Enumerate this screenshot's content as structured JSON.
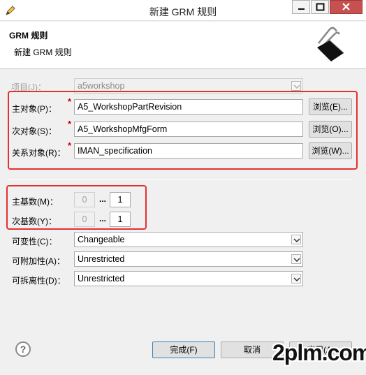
{
  "window": {
    "title": "新建 GRM 规则",
    "icon": "pencil-icon"
  },
  "header": {
    "title": "GRM 规则",
    "subtitle": "新建 GRM 规则",
    "icon": "binder-clip-icon"
  },
  "project": {
    "label": "项目(J)：",
    "value": "a5workshop"
  },
  "primary": {
    "label": "主对象(P)：",
    "value": "A5_WorkshopPartRevision",
    "browse": "浏览(E)..."
  },
  "secondary": {
    "label": "次对象(S)：",
    "value": "A5_WorkshopMfgForm",
    "browse": "浏览(O)..."
  },
  "relation": {
    "label": "关系对象(R)：",
    "value": "IMAN_specification",
    "browse": "浏览(W)..."
  },
  "required_mark": "*",
  "primary_card": {
    "label": "主基数(M)：",
    "min": "0",
    "sep": "...",
    "max": "1"
  },
  "secondary_card": {
    "label": "次基数(Y)：",
    "min": "0",
    "sep": "...",
    "max": "1"
  },
  "changeability": {
    "label": "可变性(C)：",
    "value": "Changeable"
  },
  "attachability": {
    "label": "可附加性(A)：",
    "value": "Unrestricted"
  },
  "detachability": {
    "label": "可拆离性(D)：",
    "value": "Unrestricted"
  },
  "buttons": {
    "finish": "完成(F)",
    "cancel": "取消",
    "apply": "应用(A)"
  },
  "watermark": "2plm.com",
  "colors": {
    "highlight": "#e53030",
    "close_button": "#c75050",
    "required": "#cc0000"
  }
}
